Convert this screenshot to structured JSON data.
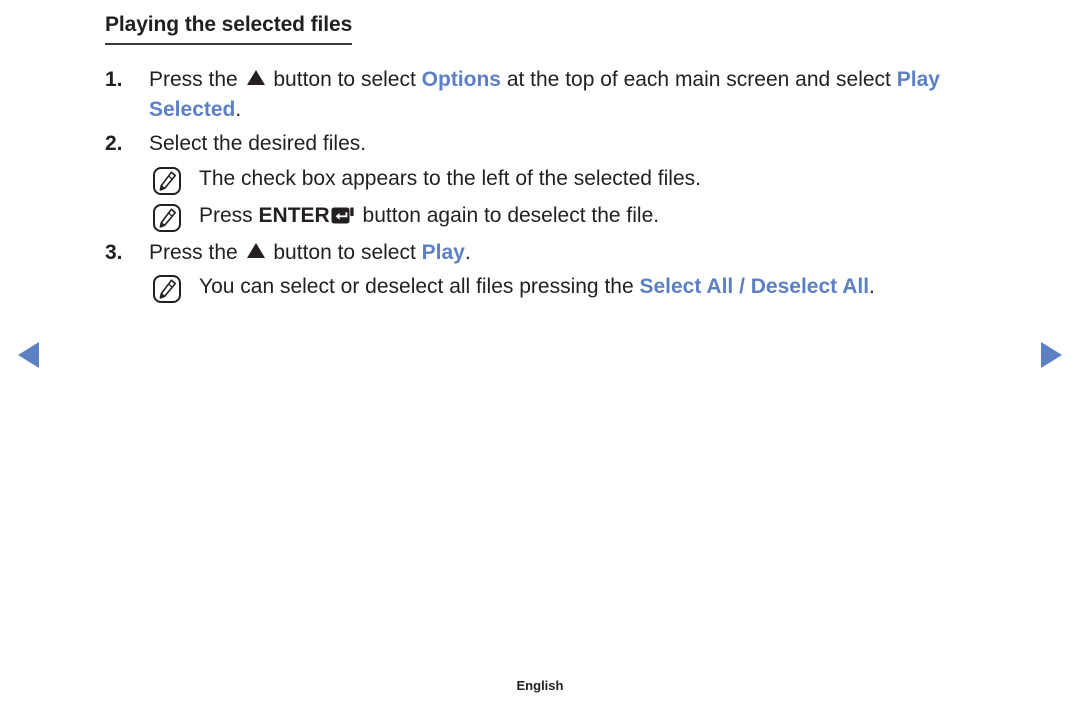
{
  "page": {
    "title": "Playing the selected files",
    "footer_label": "English",
    "accent_color": "#5d80c4",
    "text_color": "#231f20",
    "background_color": "#ffffff"
  },
  "nav": {
    "prev": {
      "icon": "triangle-left-icon",
      "label": "Previous page"
    },
    "next": {
      "icon": "triangle-right-icon",
      "label": "Next page"
    }
  },
  "steps": [
    {
      "number": "1.",
      "parts": [
        {
          "type": "text",
          "value": "Press the "
        },
        {
          "type": "glyph",
          "value": "triangle-up-icon"
        },
        {
          "type": "text",
          "value": " button to select "
        },
        {
          "type": "highlight",
          "value": "Options"
        },
        {
          "type": "text",
          "value": " at the top of each main screen and select "
        },
        {
          "type": "highlight",
          "value": "Play Selected"
        },
        {
          "type": "text",
          "value": "."
        }
      ],
      "notes": []
    },
    {
      "number": "2.",
      "parts": [
        {
          "type": "text",
          "value": "Select the desired files."
        }
      ],
      "notes": [
        {
          "icon": "note-pencil-icon",
          "parts": [
            {
              "type": "text",
              "value": "The check box appears to the left of the selected files."
            }
          ]
        },
        {
          "icon": "note-pencil-icon",
          "parts": [
            {
              "type": "text",
              "value": "Press "
            },
            {
              "type": "bold",
              "value": "ENTER"
            },
            {
              "type": "glyph",
              "value": "enter-key-icon"
            },
            {
              "type": "text",
              "value": " button again to deselect the file."
            }
          ]
        }
      ]
    },
    {
      "number": "3.",
      "parts": [
        {
          "type": "text",
          "value": "Press the "
        },
        {
          "type": "glyph",
          "value": "triangle-up-icon"
        },
        {
          "type": "text",
          "value": " button to select "
        },
        {
          "type": "highlight",
          "value": "Play"
        },
        {
          "type": "text",
          "value": "."
        }
      ],
      "notes": [
        {
          "icon": "note-pencil-icon",
          "parts": [
            {
              "type": "text",
              "value": "You can select or deselect all files pressing the "
            },
            {
              "type": "highlight",
              "value": "Select All / Deselect All"
            },
            {
              "type": "text",
              "value": "."
            }
          ]
        }
      ]
    }
  ]
}
